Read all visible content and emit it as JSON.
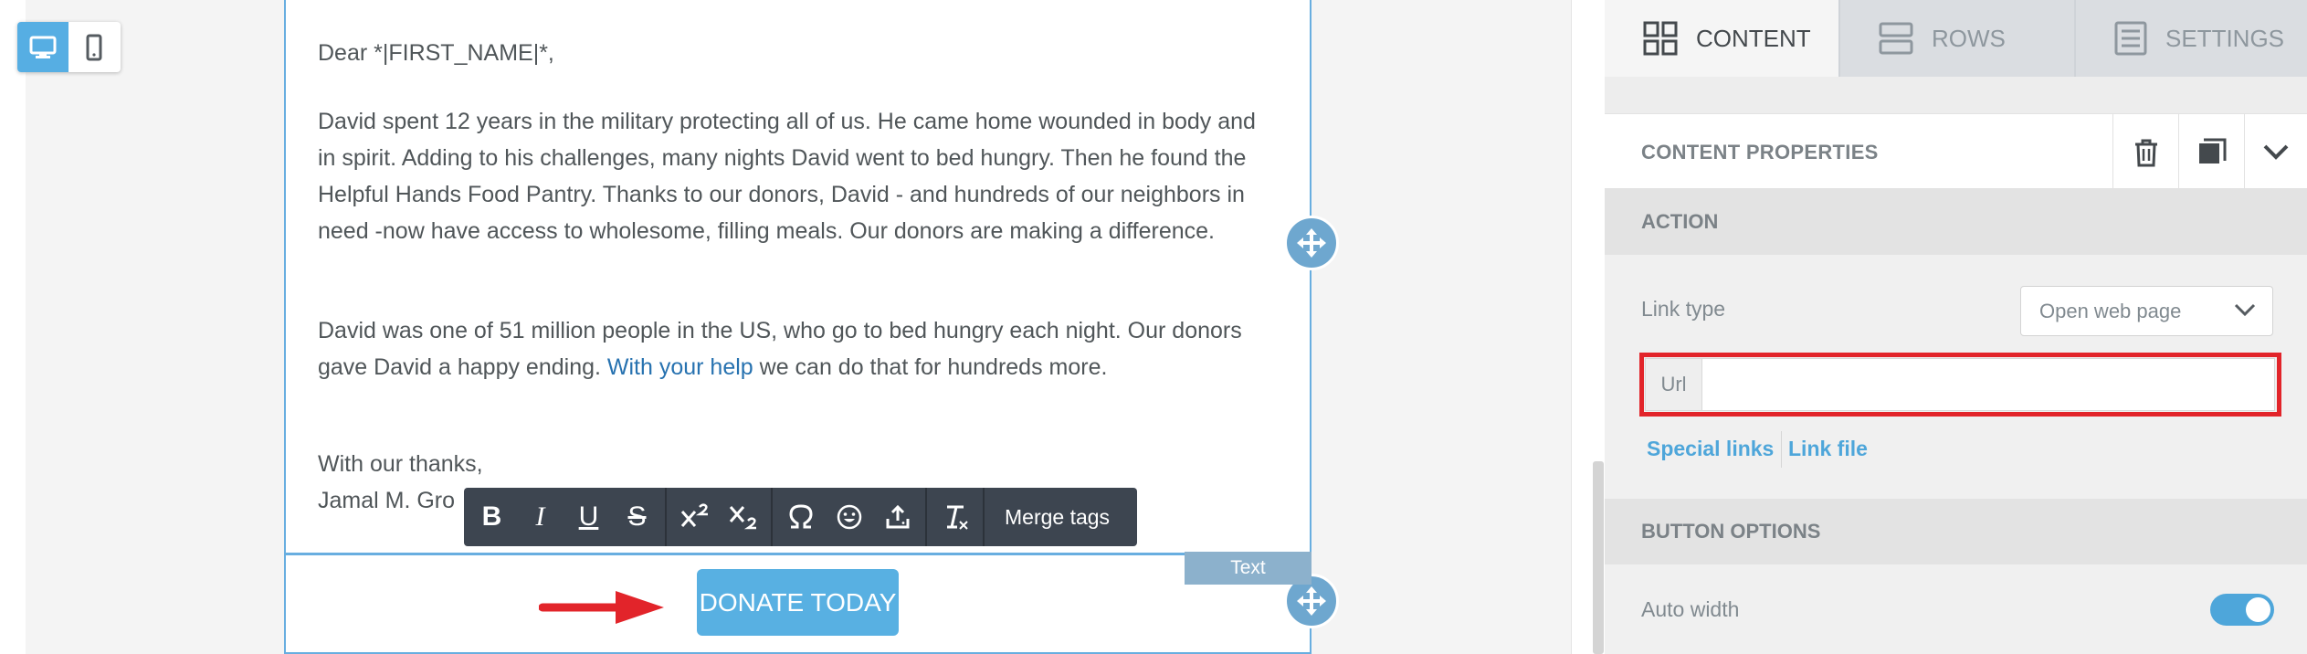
{
  "email": {
    "greeting": "Dear *|FIRST_NAME|*,",
    "para1": "David spent 12 years in the military protecting all of us. He came home wounded in body and in spirit. Adding to his challenges, many nights David went to bed hungry. Then he found the Helpful Hands Food Pantry. Thanks to our donors, David - and hundreds of our neighbors in need -now have access to wholesome, filling meals. Our donors are making a difference.",
    "para2_before": "David was one of 51 million people in the US, who go to bed hungry each night. Our donors gave David a happy ending. ",
    "para2_link": "With your help",
    "para2_after": " we can do that for hundreds more.",
    "thanks": "With our thanks,",
    "signature": "Jamal M. Gro",
    "donate_button": "DONATE TODAY",
    "block_tag": "Text"
  },
  "toolbar": {
    "bold": "B",
    "italic": "I",
    "underline": "U",
    "strike": "S",
    "merge_tags": "Merge tags"
  },
  "panel": {
    "tabs": [
      {
        "label": "CONTENT",
        "icon": "grid-icon"
      },
      {
        "label": "ROWS",
        "icon": "rows-icon"
      },
      {
        "label": "SETTINGS",
        "icon": "settings-icon"
      }
    ],
    "content_properties": "CONTENT PROPERTIES",
    "action_section": "ACTION",
    "link_type_label": "Link type",
    "link_type_value": "Open web page",
    "url_addon": "Url",
    "url_value": "",
    "special_links": "Special links",
    "link_file": "Link file",
    "button_options_section": "BUTTON OPTIONS",
    "auto_width_label": "Auto width",
    "auto_width_on": true
  },
  "colors": {
    "accent": "#56aee3",
    "selection_border": "#68aee0",
    "highlight_red": "#e2242a",
    "toolbar_bg": "#3d4550"
  }
}
